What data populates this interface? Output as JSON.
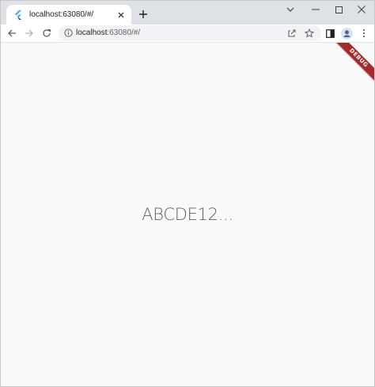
{
  "tab": {
    "title": "localhost:63080/#/",
    "favicon": "flutter-logo-icon"
  },
  "toolbar": {
    "url_host": "localhost",
    "url_rest": ":63080/#/"
  },
  "page": {
    "main_text": "ABCDE12...",
    "debug_banner": "DEBUG"
  },
  "colors": {
    "accent": "#a52a2a",
    "text": "#616161",
    "background": "#fafafa"
  }
}
